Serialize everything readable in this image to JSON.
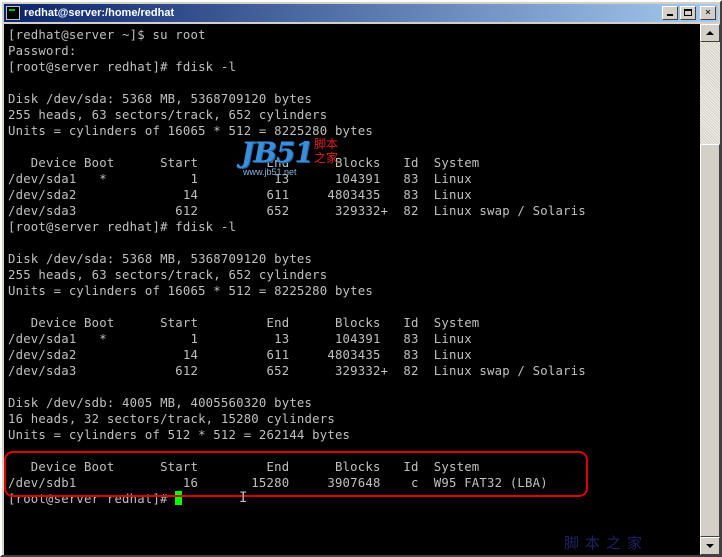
{
  "window": {
    "title": "redhat@server:/home/redhat",
    "buttons": {
      "minimize": "minimize",
      "maximize": "maximize",
      "close": "×"
    }
  },
  "terminal": {
    "lines": [
      "[redhat@server ~]$ su root",
      "Password:",
      "[root@server redhat]# fdisk -l",
      "",
      "Disk /dev/sda: 5368 MB, 5368709120 bytes",
      "255 heads, 63 sectors/track, 652 cylinders",
      "Units = cylinders of 16065 * 512 = 8225280 bytes",
      "",
      "   Device Boot      Start         End      Blocks   Id  System",
      "/dev/sda1   *           1          13      104391   83  Linux",
      "/dev/sda2              14         611     4803435   83  Linux",
      "/dev/sda3             612         652      329332+  82  Linux swap / Solaris",
      "[root@server redhat]# fdisk -l",
      "",
      "Disk /dev/sda: 5368 MB, 5368709120 bytes",
      "255 heads, 63 sectors/track, 652 cylinders",
      "Units = cylinders of 16065 * 512 = 8225280 bytes",
      "",
      "   Device Boot      Start         End      Blocks   Id  System",
      "/dev/sda1   *           1          13      104391   83  Linux",
      "/dev/sda2              14         611     4803435   83  Linux",
      "/dev/sda3             612         652      329332+  82  Linux swap / Solaris",
      "",
      "Disk /dev/sdb: 4005 MB, 4005560320 bytes",
      "16 heads, 32 sectors/track, 15280 cylinders",
      "Units = cylinders of 512 * 512 = 262144 bytes",
      "",
      "   Device Boot      Start         End      Blocks   Id  System",
      "/dev/sdb1              16       15280     3907648    c  W95 FAT32 (LBA)",
      "[root@server redhat]# "
    ],
    "text_color": "#c0c0c0",
    "cursor_color": "#00ff00",
    "highlight_color": "#e00000"
  },
  "overlay": {
    "logo_main": "JB51",
    "logo_cn": "脚本之家",
    "logo_url": "www.jb51.net",
    "watermark": "脚本之家"
  }
}
